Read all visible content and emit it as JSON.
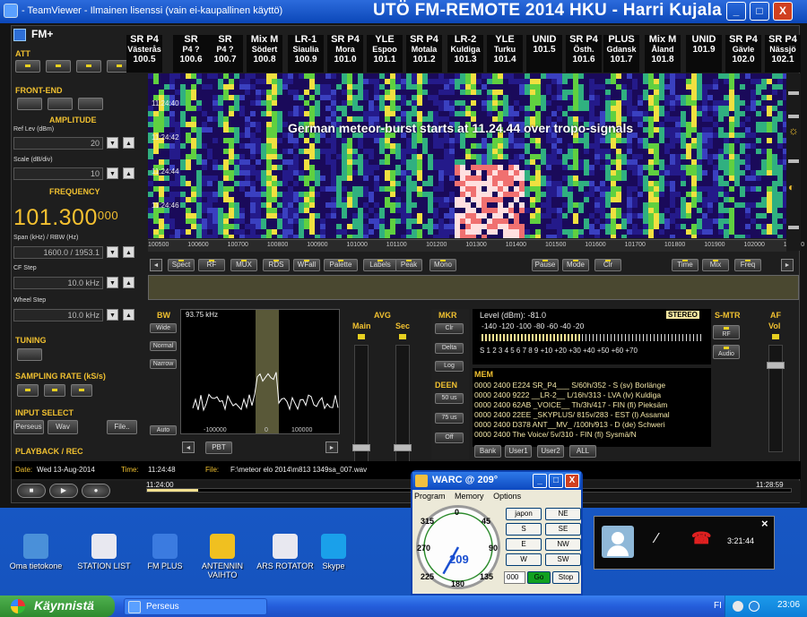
{
  "window": {
    "tv_title": "- TeamViewer - Ilmainen lisenssi (vain ei-kaupallinen käyttö)",
    "big_title": "UTÖ FM-REMOTE 2014    HKU - Harri Kujala",
    "min": "_",
    "max": "□",
    "close": "X"
  },
  "app": {
    "logo": "FM+"
  },
  "left": {
    "att": "ATT",
    "frontend": "FRONT-END",
    "amplitude": "AMPLITUDE",
    "ref_lev_label": "Ref Lev (dBm)",
    "ref_lev_value": "20",
    "scale_label": "Scale (dB/div)",
    "scale_value": "10",
    "frequency": "FREQUENCY",
    "freq_main": "101.300",
    "freq_small": "000",
    "span_label": "Span (kHz) / RBW (Hz)",
    "span_value": "1600.0 / 1953.1",
    "cf_step_label": "CF Step",
    "cf_step_value": "10.0 kHz",
    "wheel_step_label": "Wheel Step",
    "wheel_step_value": "10.0 kHz",
    "tuning": "TUNING",
    "sampling": "SAMPLING RATE (kS/s)",
    "input_select": "INPUT SELECT",
    "input_perseus": "Perseus",
    "input_wav": "Wav",
    "file_btn": "File..",
    "playback": "PLAYBACK / REC"
  },
  "stations": [
    {
      "name": "SR P4",
      "sub": "Västerås",
      "freq": "100.5"
    },
    {
      "name": "SR",
      "sub": "P4 ?",
      "freq": "100.6"
    },
    {
      "name": "SR",
      "sub": "P4 ?",
      "freq": "100.7"
    },
    {
      "name": "Mix M",
      "sub": "Södert",
      "freq": "100.8"
    },
    {
      "name": "LR-1",
      "sub": "Siaulia",
      "freq": "100.9"
    },
    {
      "name": "SR P4",
      "sub": "Mora",
      "freq": "101.0"
    },
    {
      "name": "YLE",
      "sub": "Espoo",
      "freq": "101.1"
    },
    {
      "name": "SR P4",
      "sub": "Motala",
      "freq": "101.2"
    },
    {
      "name": "LR-2",
      "sub": "Kuldiga",
      "freq": "101.3"
    },
    {
      "name": "YLE",
      "sub": "Turku",
      "freq": "101.4"
    },
    {
      "name": "UNID",
      "sub": "",
      "freq": "101.5"
    },
    {
      "name": "SR P4",
      "sub": "Östh.",
      "freq": "101.6"
    },
    {
      "name": "PLUS",
      "sub": "Gdansk",
      "freq": "101.7"
    },
    {
      "name": "Mix M",
      "sub": "Åland",
      "freq": "101.8"
    },
    {
      "name": "UNID",
      "sub": "",
      "freq": "101.9"
    },
    {
      "name": "SR P4",
      "sub": "Gävle",
      "freq": "102.0"
    },
    {
      "name": "SR P4",
      "sub": "Nässjö",
      "freq": "102.1"
    }
  ],
  "waterfall": {
    "banner": "German meteor-burst starts at 11.24.44 over tropo-signals",
    "timestamps": [
      "11:24:40",
      "11:24:42",
      "11:24:44",
      "11:24:46"
    ],
    "axis_labels": [
      "100500",
      "100600",
      "100700",
      "100800",
      "100900",
      "101000",
      "101100",
      "101200",
      "101300",
      "101400",
      "101500",
      "101600",
      "101700",
      "101800",
      "101900",
      "102000",
      "102100"
    ]
  },
  "toolbar": [
    "Spect",
    "RF",
    "MUX",
    "RDS",
    "WFall",
    "Palette",
    "Labels",
    "Peak",
    "Mono",
    "Pause",
    "Mode",
    "Clr",
    "Time",
    "Mix",
    "Freq"
  ],
  "bw": {
    "title": "BW",
    "wide": "Wide",
    "normal": "Normal",
    "narrow": "Narrow",
    "auto": "Auto",
    "khz": "93.75 kHz",
    "ax1": "-100000",
    "ax2": "0",
    "ax3": "100000",
    "pbt": "PBT"
  },
  "avg": {
    "title": "AVG",
    "main": "Main",
    "sec": "Sec"
  },
  "mkr": {
    "title": "MKR",
    "clr": "Clr",
    "delta": "Delta",
    "log": "Log",
    "deen": "DEEN",
    "us50": "50 us",
    "us75": "75 us",
    "off": "Off"
  },
  "smeter": {
    "level": "Level (dBm):   -81.0",
    "stereo": "STEREO",
    "scale_top": "-140   -120   -100    -80    -60    -40    -20",
    "scale_bot": "S  1  2  3  4  5  6  7  8  9  +10 +20 +30 +40 +50 +60 +70",
    "smtr": "S-MTR",
    "rf": "RF",
    "audio": "Audio",
    "af": "AF",
    "vol": "Vol"
  },
  "mem": {
    "title": "MEM",
    "rows": [
      "0000 2400 E224 SR_P4___ S/60h/352 - S (sv)  Borlänge",
      "0000 2400 9222 __LR-2__ L/16h/313 - LVA (lv)  Kuldiga",
      "0000 2400 62AB _VOICE__ Th/3h/417 - FIN (fi)  Pieksäm",
      "0000 2400 22EE _SKYPLUS/ 815v/283 - EST (l)  Assamal",
      "0000 2400 D378 ANT__MV_ /100h/913 - D (de)  Schwerі",
      "0000 2400 The Voice/ 5v/310 - FIN (fi)  Sysmä/N"
    ],
    "bank": "Bank",
    "user1": "User1",
    "user2": "User2",
    "all": "ALL"
  },
  "status": {
    "date_label": "Date:",
    "date_value": "Wed 13-Aug-2014",
    "time_label": "Time:",
    "time_value": "11:24:48",
    "file_label": "File:",
    "file_value": "F:\\meteor elo 2014\\m813 1349sa_007.wav",
    "start": "11:24:00",
    "end": "11:28:59",
    "progress": 0.08
  },
  "warc": {
    "title": "WARC @ 209°",
    "menu": [
      "Program",
      "Memory",
      "Options"
    ],
    "compass": {
      "n": "0",
      "e": "45",
      "ne_l": "315",
      "w": "270",
      "s": "180",
      "se": "135",
      "sw": "225",
      "value": "209",
      "east90": "90"
    },
    "buttons": [
      "japon",
      "NE",
      "S",
      "SE",
      "E",
      "NW",
      "W",
      "SW"
    ],
    "input": "000",
    "go": "Go",
    "stop": "Stop"
  },
  "desktop_icons": [
    {
      "label": "Oma tietokone",
      "color": "#4a90d9"
    },
    {
      "label": "STATION LIST",
      "color": "#e8e8f0"
    },
    {
      "label": "FM PLUS",
      "color": "#3b7be0"
    },
    {
      "label": "ANTENNIN VAIHTO",
      "color": "#f0c020"
    },
    {
      "label": "ARS ROTATOR",
      "color": "#e8e8f0"
    },
    {
      "label": "Skype",
      "color": "#1aa0ea"
    }
  ],
  "call": {
    "time": "3:21:44",
    "close": "×"
  },
  "taskbar": {
    "start": "Käynnistä",
    "task": "Perseus",
    "lang": "FI",
    "clock": "23:06"
  }
}
